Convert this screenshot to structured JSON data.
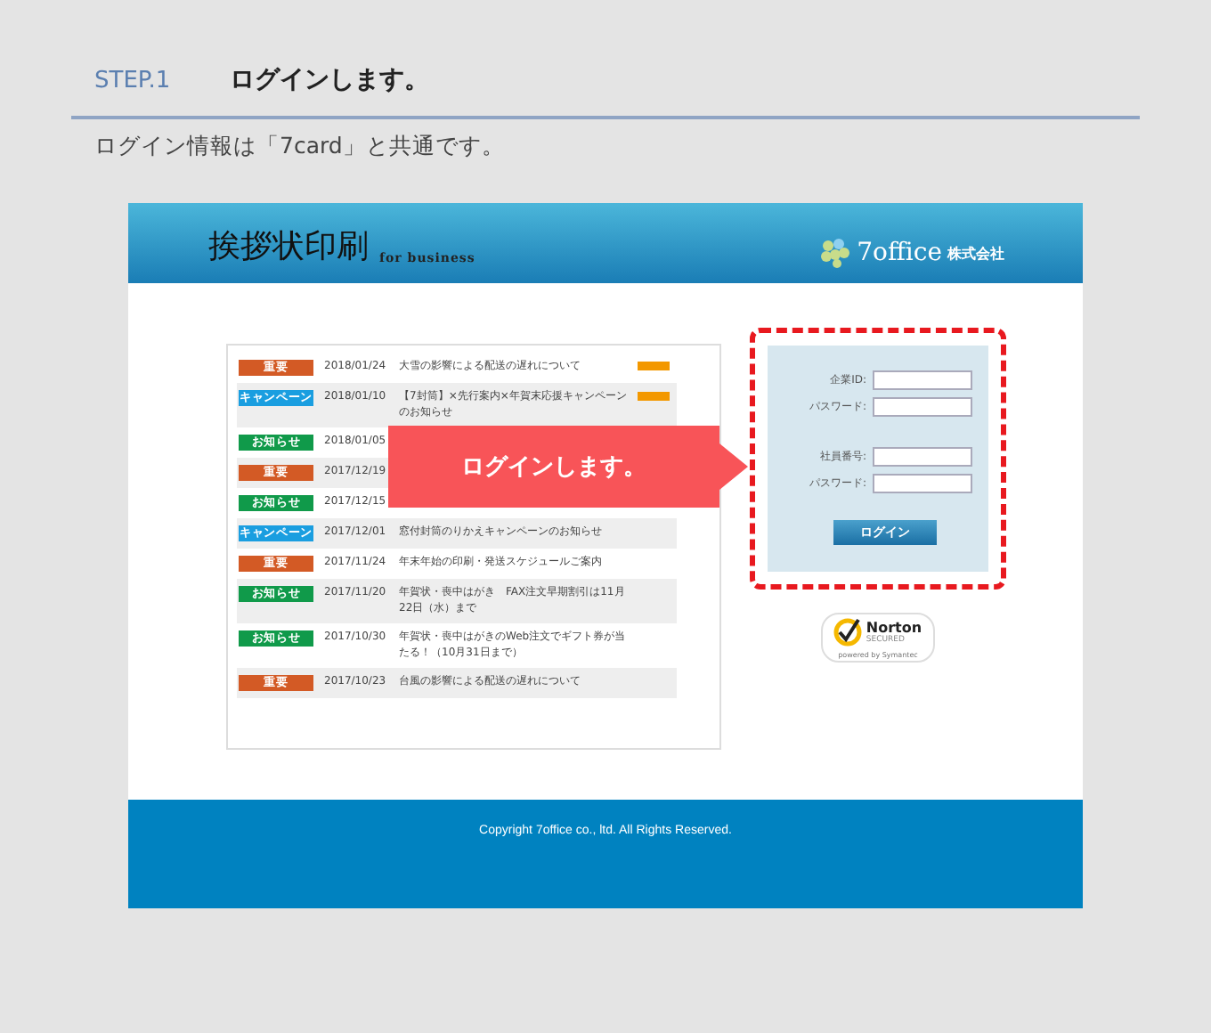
{
  "step": {
    "label": "STEP.1",
    "title": "ログインします。"
  },
  "description": "ログイン情報は「7card」と共通です。",
  "site": {
    "title": "挨拶状印刷",
    "subtitle": "for business",
    "logo": {
      "brand": "7office",
      "suffix": "株式会社"
    },
    "news": [
      {
        "tag": "重要",
        "color": "#d35a25",
        "date": "2018/01/24",
        "text": "大雪の影響による配送の遅れについて",
        "flag": {
          "color": "#f39800"
        }
      },
      {
        "tag": "キャンペーン",
        "color": "#1a9ee0",
        "date": "2018/01/10",
        "text": "【7封筒】×先行案内×年賀末応援キャンペーンのお知らせ",
        "flag": {
          "color": "#f39800"
        }
      },
      {
        "tag": "お知らせ",
        "color": "#109a4a",
        "date": "2018/01/05"
      },
      {
        "tag": "重要",
        "color": "#d35a25",
        "date": "2017/12/19"
      },
      {
        "tag": "お知らせ",
        "color": "#109a4a",
        "date": "2017/12/15"
      },
      {
        "tag": "キャンペーン",
        "color": "#1a9ee0",
        "date": "2017/12/01",
        "text": "窓付封筒のりかえキャンペーンのお知らせ"
      },
      {
        "tag": "重要",
        "color": "#d35a25",
        "date": "2017/11/24",
        "text": "年末年始の印刷・発送スケジュールご案内"
      },
      {
        "tag": "お知らせ",
        "color": "#109a4a",
        "date": "2017/11/20",
        "text": "年賀状・喪中はがき　FAX注文早期割引は11月22日（水）まで"
      },
      {
        "tag": "お知らせ",
        "color": "#109a4a",
        "date": "2017/10/30",
        "text": "年賀状・喪中はがきのWeb注文でギフト券が当たる！（10月31日まで）"
      },
      {
        "tag": "重要",
        "color": "#d35a25",
        "date": "2017/10/23",
        "text": "台風の影響による配送の遅れについて"
      }
    ],
    "login": {
      "groups": [
        {
          "fields": [
            {
              "label": "企業ID:"
            },
            {
              "label": "パスワード:"
            }
          ]
        },
        {
          "fields": [
            {
              "label": "社員番号:"
            },
            {
              "label": "パスワード:"
            }
          ]
        }
      ],
      "button": "ログイン"
    },
    "badge": {
      "name": "Norton",
      "sub": "SECURED",
      "powered": "powered by Symantec"
    },
    "footer": "Copyright 7office co., ltd. All Rights Reserved."
  },
  "callout": "ログインします。"
}
